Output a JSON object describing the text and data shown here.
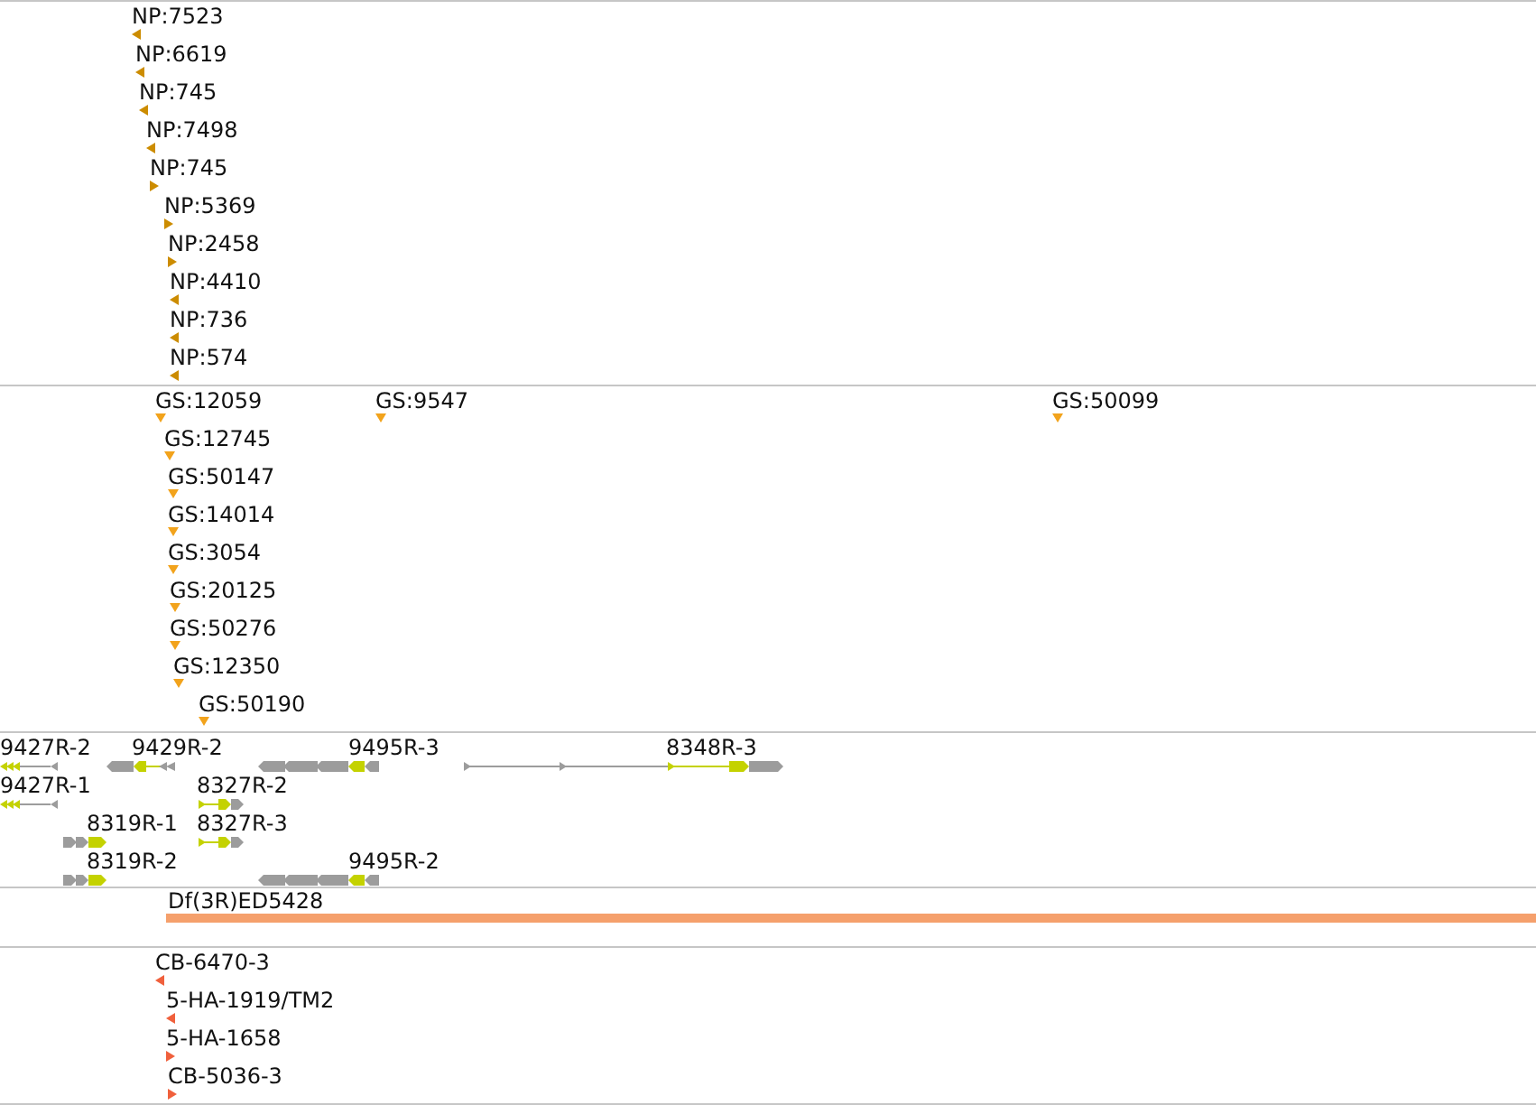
{
  "tracks": [
    {
      "kind": "stranded",
      "color": "#cc8c00",
      "features": [
        {
          "label": "NP:7523",
          "reverse": true
        },
        {
          "label": "NP:6619",
          "reverse": true
        },
        {
          "label": "NP:745",
          "reverse": true
        },
        {
          "label": "NP:7498",
          "reverse": true
        },
        {
          "label": "NP:745",
          "reverse": false
        },
        {
          "label": "NP:5369",
          "reverse": false
        },
        {
          "label": "NP:2458",
          "reverse": false
        },
        {
          "label": "NP:4410",
          "reverse": true
        },
        {
          "label": "NP:736",
          "reverse": true
        },
        {
          "label": "NP:574",
          "reverse": true
        }
      ]
    },
    {
      "kind": "unstranded",
      "color": "#f2a31c",
      "features": [
        {
          "label": "GS:12059"
        },
        {
          "label": "GS:9547"
        },
        {
          "label": "GS:50099"
        },
        {
          "label": "GS:12745"
        },
        {
          "label": "GS:50147"
        },
        {
          "label": "GS:14014"
        },
        {
          "label": "GS:3054"
        },
        {
          "label": "GS:20125"
        },
        {
          "label": "GS:50276"
        },
        {
          "label": "GS:12350"
        },
        {
          "label": "GS:50190"
        }
      ]
    },
    {
      "kind": "genes",
      "features": [
        {
          "label": "9427R-2",
          "reverse": true
        },
        {
          "label": "9429R-2",
          "reverse": true
        },
        {
          "label": "9495R-3",
          "reverse": true
        },
        {
          "label": "8348R-3",
          "reverse": false
        },
        {
          "label": "9427R-1",
          "reverse": true
        },
        {
          "label": "8327R-2",
          "reverse": false
        },
        {
          "label": "8319R-1",
          "reverse": false
        },
        {
          "label": "8327R-3",
          "reverse": false
        },
        {
          "label": "8319R-2",
          "reverse": false
        },
        {
          "label": "9495R-2",
          "reverse": true
        }
      ]
    },
    {
      "kind": "span",
      "color": "#f5a06c",
      "features": [
        {
          "label": "Df(3R)ED5428"
        }
      ]
    },
    {
      "kind": "stranded",
      "color": "#f0603c",
      "features": [
        {
          "label": "CB-6470-3",
          "reverse": true
        },
        {
          "label": "5-HA-1919/TM2",
          "reverse": true
        },
        {
          "label": "5-HA-1658",
          "reverse": false
        },
        {
          "label": "CB-5036-3",
          "reverse": false
        }
      ]
    }
  ]
}
